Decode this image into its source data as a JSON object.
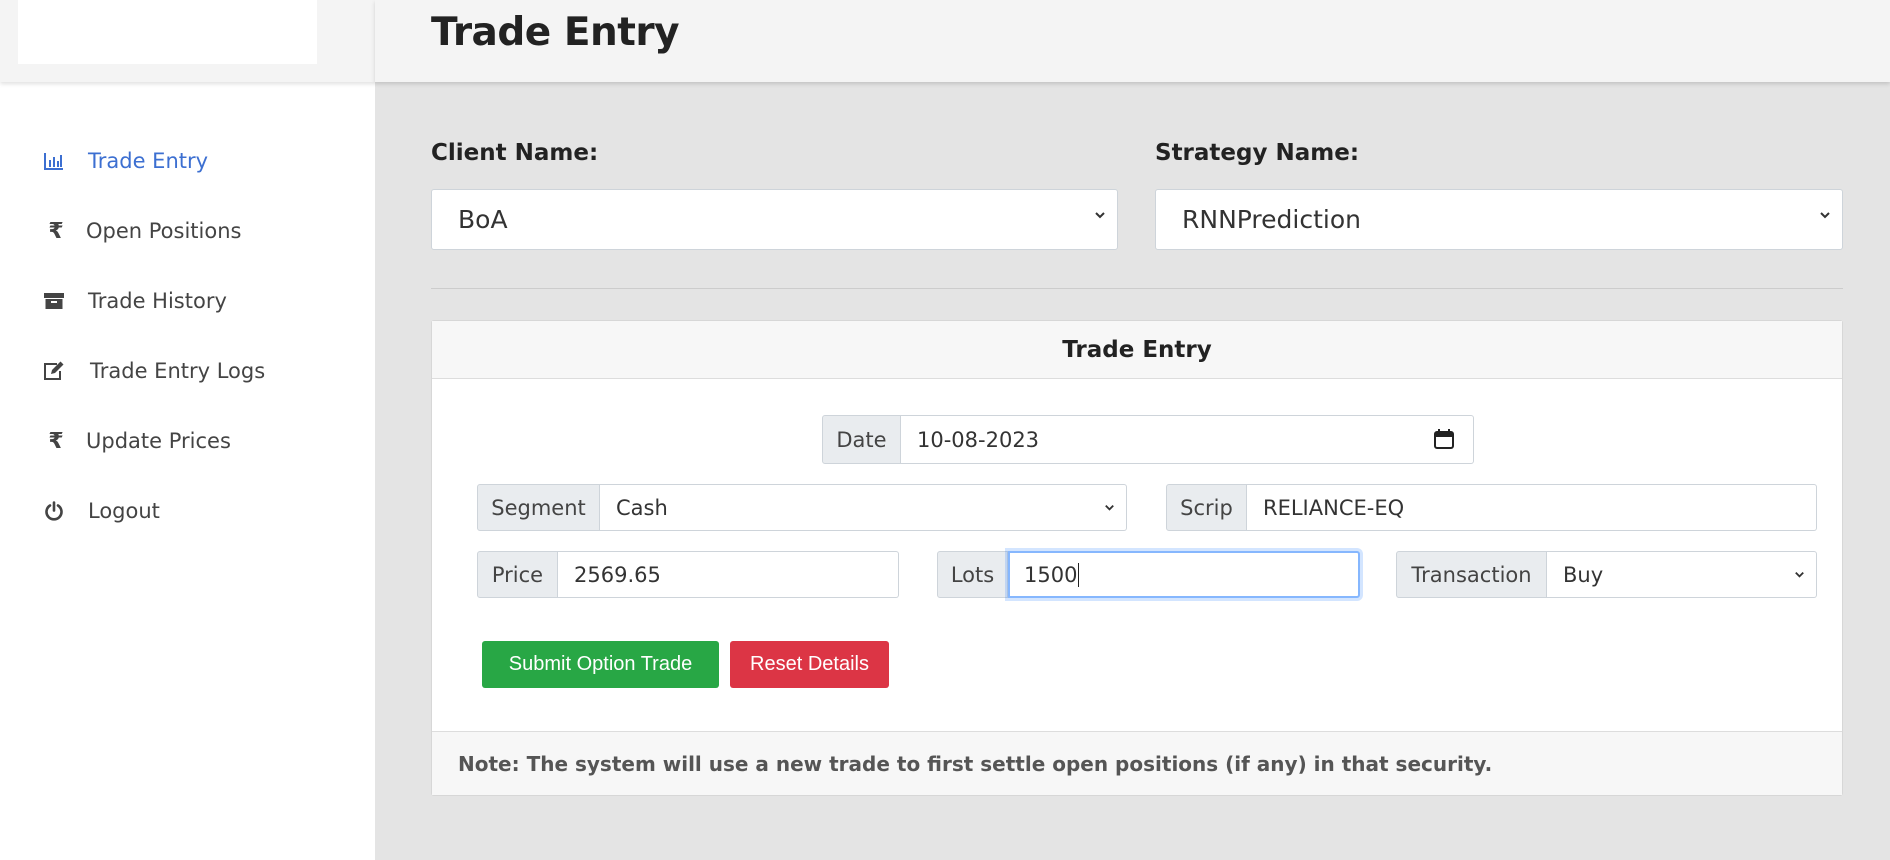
{
  "header": {
    "title": "Trade Entry"
  },
  "sidebar": {
    "items": [
      {
        "label": "Trade Entry",
        "icon": "bar-chart-icon",
        "active": true
      },
      {
        "label": "Open Positions",
        "icon": "rupee-icon"
      },
      {
        "label": "Trade History",
        "icon": "archive-icon"
      },
      {
        "label": "Trade Entry Logs",
        "icon": "edit-icon"
      },
      {
        "label": "Update Prices",
        "icon": "rupee-icon"
      },
      {
        "label": "Logout",
        "icon": "power-icon"
      }
    ]
  },
  "form": {
    "client_label": "Client Name:",
    "client_value": "BoA",
    "strategy_label": "Strategy Name:",
    "strategy_value": "RNNPrediction"
  },
  "card": {
    "title": "Trade Entry",
    "date_label": "Date",
    "date_value": "10-08-2023",
    "segment_label": "Segment",
    "segment_value": "Cash",
    "scrip_label": "Scrip",
    "scrip_value": "RELIANCE-EQ",
    "price_label": "Price",
    "price_value": "2569.65",
    "lots_label": "Lots",
    "lots_value": "1500",
    "transaction_label": "Transaction",
    "transaction_value": "Buy",
    "submit_label": "Submit Option Trade",
    "reset_label": "Reset Details",
    "note": "Note: The system will use a new trade to first settle open positions (if any) in that security."
  },
  "colors": {
    "accent": "#3c6fd1",
    "submit": "#28a745",
    "reset": "#dc3545"
  }
}
